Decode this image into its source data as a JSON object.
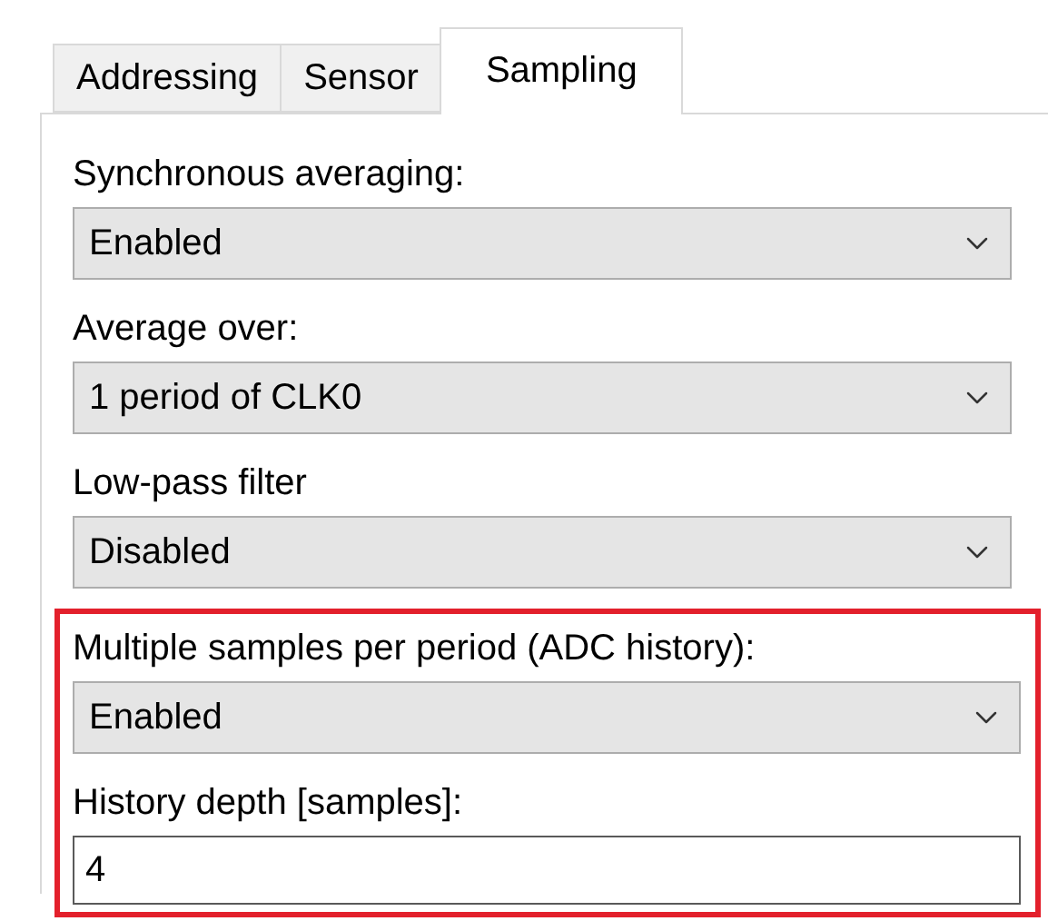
{
  "tabs": [
    {
      "label": "Addressing",
      "selected": false
    },
    {
      "label": "Sensor",
      "selected": false
    },
    {
      "label": "Sampling",
      "selected": true
    }
  ],
  "sections": [
    {
      "highlighted": false,
      "fields": [
        {
          "kind": "dropdown",
          "label": "Synchronous averaging:",
          "value": "Enabled"
        },
        {
          "kind": "dropdown",
          "label": "Average over:",
          "value": "1 period of CLK0"
        },
        {
          "kind": "dropdown",
          "label": "Low-pass filter",
          "value": "Disabled"
        }
      ]
    },
    {
      "highlighted": true,
      "fields": [
        {
          "kind": "dropdown",
          "label": "Multiple samples per period (ADC history):",
          "value": "Enabled"
        },
        {
          "kind": "text",
          "label": "History depth [samples]:",
          "value": "4"
        }
      ]
    }
  ]
}
